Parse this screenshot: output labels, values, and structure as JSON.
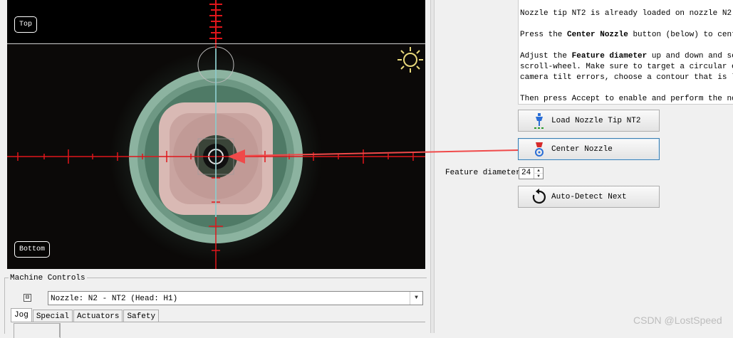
{
  "camera": {
    "top_label": "Top",
    "bottom_label": "Bottom",
    "brightness_icon": "sun-icon"
  },
  "machine_controls": {
    "title": "Machine Controls",
    "collapse_symbol": "⊟",
    "nozzle_select_value": "Nozzle: N2 - NT2 (Head: H1)",
    "tabs": [
      "Jog",
      "Special",
      "Actuators",
      "Safety"
    ],
    "active_tab": "Jog"
  },
  "instructions": {
    "line1": "Nozzle tip NT2 is already loaded on nozzle N2.",
    "line2_pre": "Press the ",
    "line2_bold": "Center Nozzle",
    "line2_post": " button (below) to center",
    "line3_pre": "Adjust the ",
    "line3_bold": "Feature diameter",
    "line3_post": " up and down and see",
    "line4": "scroll-wheel. Make sure to target a circular edge",
    "line5": "camera tilt errors, choose a contour that is lowes",
    "line6": "Then press Accept to enable and perform the nozzle"
  },
  "buttons": {
    "load_nozzle_tip": "Load Nozzle Tip NT2",
    "center_nozzle": "Center Nozzle",
    "auto_detect_next": "Auto-Detect Next"
  },
  "feature_diameter": {
    "label": "Feature diameter",
    "value": "24"
  },
  "watermark": "CSDN @LostSpeed",
  "colors": {
    "crosshair_red": "#e0161b",
    "crosshair_cyan": "#7fe8e8",
    "arrow_red": "#f04a4a",
    "button_focus": "#3c7fb1"
  }
}
